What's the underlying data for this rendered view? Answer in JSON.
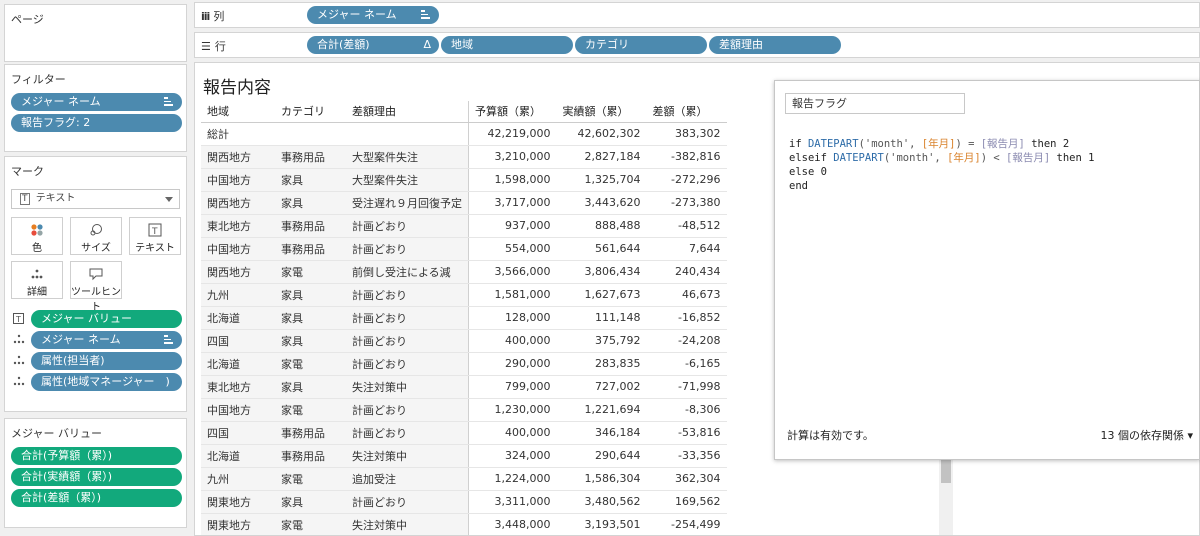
{
  "left": {
    "pages_title": "ページ",
    "filters_title": "フィルター",
    "filters": [
      "メジャー ネーム",
      "報告フラグ: 2"
    ],
    "marks_title": "マーク",
    "mark_type": "テキスト",
    "mark_buttons": [
      "色",
      "サイズ",
      "テキスト",
      "詳細",
      "ツールヒント"
    ],
    "mark_fields": [
      "メジャー バリュー",
      "メジャー ネーム",
      "属性(担当者)",
      "属性(地域マネージャー　)"
    ],
    "measure_values_title": "メジャー バリュー",
    "measure_values": [
      "合計(予算額（累）)",
      "合計(実績額（累）)",
      "合計(差額（累）)"
    ]
  },
  "shelves": {
    "columns_label": "列",
    "columns": [
      "メジャー ネーム"
    ],
    "rows_label": "行",
    "rows": [
      "合計(差額)",
      "地域",
      "カテゴリ",
      "差額理由"
    ],
    "delta_symbol": "Δ"
  },
  "view": {
    "title": "報告内容",
    "headers": [
      "地域",
      "カテゴリ",
      "差額理由",
      "予算額（累）",
      "実績額（累）",
      "差額（累）"
    ],
    "total_label": "総計",
    "total": [
      "42,219,000",
      "42,602,302",
      "383,302"
    ],
    "rows": [
      [
        "関西地方",
        "事務用品",
        "大型案件失注",
        "3,210,000",
        "2,827,184",
        "-382,816"
      ],
      [
        "中国地方",
        "家具",
        "大型案件失注",
        "1,598,000",
        "1,325,704",
        "-272,296"
      ],
      [
        "関西地方",
        "家具",
        "受注遅れ９月回復予定",
        "3,717,000",
        "3,443,620",
        "-273,380"
      ],
      [
        "東北地方",
        "事務用品",
        "計画どおり",
        "937,000",
        "888,488",
        "-48,512"
      ],
      [
        "中国地方",
        "事務用品",
        "計画どおり",
        "554,000",
        "561,644",
        "7,644"
      ],
      [
        "関西地方",
        "家電",
        "前倒し受注による減",
        "3,566,000",
        "3,806,434",
        "240,434"
      ],
      [
        "九州",
        "家具",
        "計画どおり",
        "1,581,000",
        "1,627,673",
        "46,673"
      ],
      [
        "北海道",
        "家具",
        "計画どおり",
        "128,000",
        "111,148",
        "-16,852"
      ],
      [
        "四国",
        "家具",
        "計画どおり",
        "400,000",
        "375,792",
        "-24,208"
      ],
      [
        "北海道",
        "家電",
        "計画どおり",
        "290,000",
        "283,835",
        "-6,165"
      ],
      [
        "東北地方",
        "家具",
        "失注対策中",
        "799,000",
        "727,002",
        "-71,998"
      ],
      [
        "中国地方",
        "家電",
        "計画どおり",
        "1,230,000",
        "1,221,694",
        "-8,306"
      ],
      [
        "四国",
        "事務用品",
        "計画どおり",
        "400,000",
        "346,184",
        "-53,816"
      ],
      [
        "北海道",
        "事務用品",
        "失注対策中",
        "324,000",
        "290,644",
        "-33,356"
      ],
      [
        "九州",
        "家電",
        "追加受注",
        "1,224,000",
        "1,586,304",
        "362,304"
      ],
      [
        "関東地方",
        "家具",
        "計画どおり",
        "3,311,000",
        "3,480,562",
        "169,562"
      ],
      [
        "関東地方",
        "家電",
        "失注対策中",
        "3,448,000",
        "3,193,501",
        "-254,499"
      ]
    ]
  },
  "calc": {
    "name": "報告フラグ",
    "status": "計算は有効です。",
    "deps": "13 個の依存関係 ▾",
    "code": {
      "if": "if",
      "datepart": "DATEPART",
      "month_str": "('month', ",
      "field_year_month": "[年月]",
      "close_eq": ") = ",
      "param": "[報告月]",
      "then2": " then 2",
      "elseif": "elseif",
      "close_lt": ") < ",
      "then1": " then 1",
      "else0": "else 0",
      "end": "end"
    }
  }
}
